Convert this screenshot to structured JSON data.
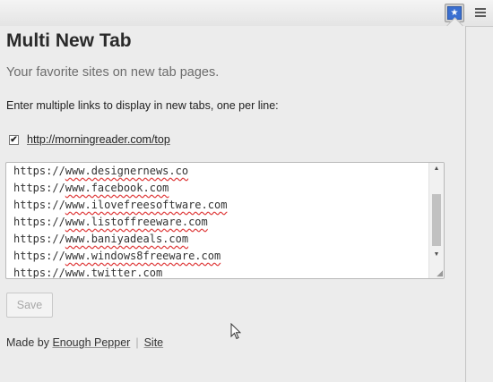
{
  "toolbar": {
    "extension_icon": "star-icon",
    "menu_icon": "hamburger-menu-icon",
    "star_glyph": "★"
  },
  "popup": {
    "title": "Multi New Tab",
    "subtitle": "Your favorite sites on new tab pages.",
    "instructions": "Enter multiple links to display in new tabs, one per line:",
    "checkbox": {
      "checked": true,
      "label": "http://morningreader.com/top"
    },
    "links": [
      {
        "proto": "https://",
        "host": "www.designernews.co"
      },
      {
        "proto": "https://",
        "host": "www.facebook.com"
      },
      {
        "proto": "https://",
        "host": "www.ilovefreesoftware.com"
      },
      {
        "proto": "https://",
        "host": "www.listoffreeware.com"
      },
      {
        "proto": "https://",
        "host": "www.baniyadeals.com"
      },
      {
        "proto": "https://",
        "host": "www.windows8freeware.com"
      },
      {
        "proto": "https://",
        "host": "www.twitter.com"
      }
    ],
    "save_label": "Save",
    "footer": {
      "made_by": "Made by",
      "author": "Enough Pepper",
      "separator": "|",
      "site": "Site"
    }
  }
}
